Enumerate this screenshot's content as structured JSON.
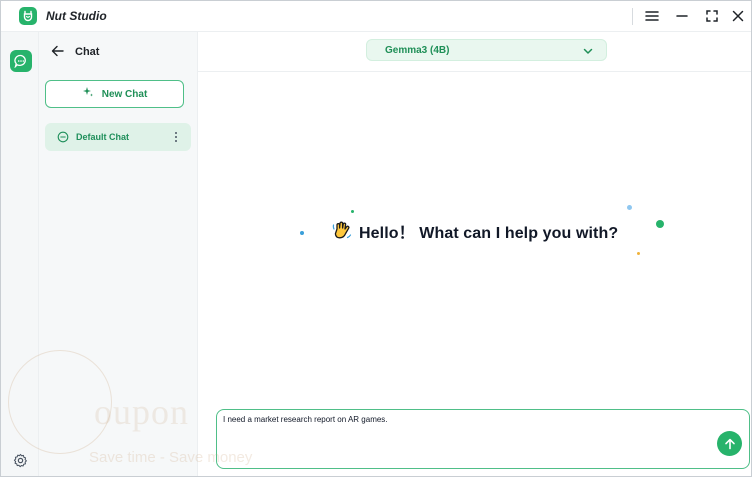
{
  "app": {
    "title": "Nut Studio",
    "icons": {
      "logo": "nut-logo-icon",
      "menu": "hamburger-menu-icon",
      "minimize": "minimize-icon",
      "maximize": "maximize-icon",
      "close": "close-icon"
    }
  },
  "rail": {
    "items": [
      {
        "icon": "chat-bubble-icon",
        "active": true
      }
    ],
    "settings_icon": "gear-icon"
  },
  "sidebar": {
    "title": "Chat",
    "new_chat_label": "New Chat",
    "chats": [
      {
        "label": "Default Chat",
        "active": true
      }
    ]
  },
  "main": {
    "model": {
      "selected": "Gemma3 (4B)"
    },
    "greeting": "Hello！ What can I help you with?",
    "input": {
      "value": "I need a market research report on AR games."
    }
  },
  "watermark": {
    "word": "oupon",
    "tagline": "Save time - Save money"
  },
  "colors": {
    "accent": "#27b36b",
    "accent_dark": "#1f8f57",
    "accent_light": "#e9f7ef",
    "selected_bg": "#dff2e8"
  }
}
